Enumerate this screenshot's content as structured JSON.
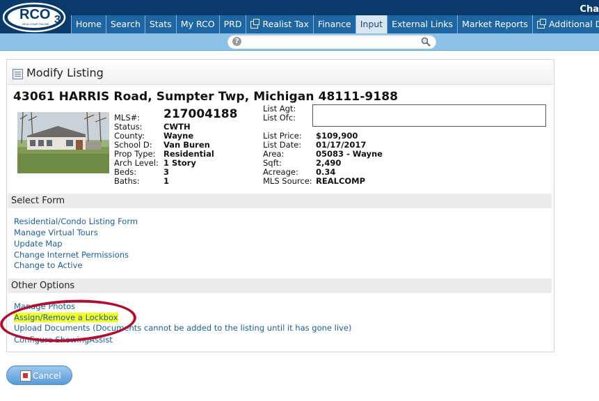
{
  "header": {
    "logo_text": "RCO",
    "logo_sub": "REALCOMP ONLINE",
    "user_name": "Cha",
    "nav": [
      {
        "label": "Home",
        "external": false,
        "active": false
      },
      {
        "label": "Search",
        "external": false,
        "active": false
      },
      {
        "label": "Stats",
        "external": false,
        "active": false
      },
      {
        "label": "My RCO",
        "external": false,
        "active": false
      },
      {
        "label": "PRD",
        "external": false,
        "active": false
      },
      {
        "label": "Realist Tax",
        "external": true,
        "active": false
      },
      {
        "label": "Finance",
        "external": false,
        "active": false
      },
      {
        "label": "Input",
        "external": false,
        "active": true
      },
      {
        "label": "External Links",
        "external": false,
        "active": false
      },
      {
        "label": "Market Reports",
        "external": false,
        "active": false
      },
      {
        "label": "Additional Data",
        "external": true,
        "active": false
      }
    ],
    "search": {
      "placeholder": "",
      "help_icon": "help-icon",
      "search_icon": "magnifier-icon"
    }
  },
  "panel": {
    "title": "Modify Listing",
    "title_icon": "form-icon"
  },
  "listing": {
    "address": "43061 HARRIS Road, Sumpter Twp, Michigan 48111-9188",
    "left": {
      "mls_label": "MLS#:",
      "mls_value": "217004188",
      "status_label": "Status:",
      "status_value": "CWTH",
      "county_label": "County:",
      "county_value": "Wayne",
      "school_label": "School D:",
      "school_value": "Van Buren",
      "prop_type_label": "Prop Type:",
      "prop_type_value": "Residential",
      "arch_label": "Arch Level:",
      "arch_value": "1 Story",
      "beds_label": "Beds:",
      "beds_value": "3",
      "baths_label": "Baths:",
      "baths_value": "1"
    },
    "right": {
      "list_agt_label": "List Agt:",
      "list_ofc_label": "List Ofc:",
      "price_label": "List Price:",
      "price_value": "$109,900",
      "date_label": "List Date:",
      "date_value": "01/17/2017",
      "area_label": "Area:",
      "area_value": "05083 - Wayne",
      "sqft_label": "Sqft:",
      "sqft_value": "2,490",
      "acreage_label": "Acreage:",
      "acreage_value": "0.34",
      "source_label": "MLS Source:",
      "source_value": "REALCOMP"
    }
  },
  "select_form": {
    "title": "Select Form",
    "links": [
      "Residential/Condo Listing Form",
      "Manage Virtual Tours",
      "Update Map",
      "Change Internet Permissions",
      "Change to Active"
    ]
  },
  "other_options": {
    "title": "Other Options",
    "links": [
      "Manage Photos",
      "Assign/Remove a Lockbox",
      "Upload Documents (Documents cannot be added to the listing until it has gone live)",
      "Configure ShowingAssist"
    ]
  },
  "footer": {
    "cancel_label": "Cancel"
  },
  "colors": {
    "header_bg": "#0a3a6b",
    "nav_bg": "#1e65a3",
    "nav_active_bg": "#d9e6f2",
    "link": "#1d5e96",
    "highlight": "#f4ff2a",
    "annotation_oval": "#b01030"
  }
}
